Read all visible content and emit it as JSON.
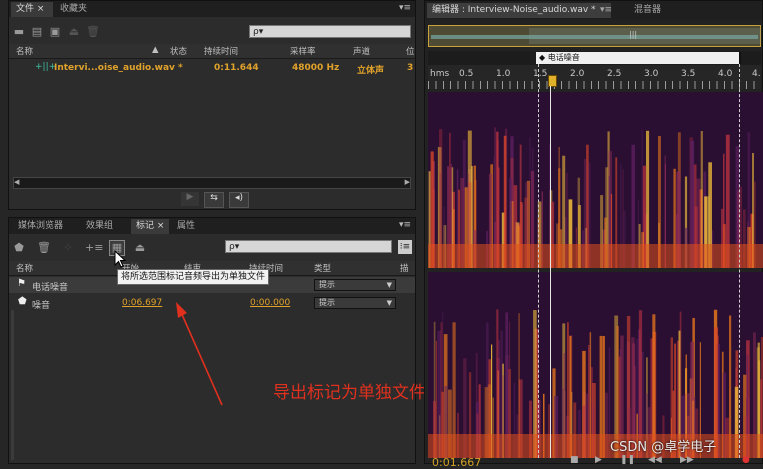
{
  "files_panel": {
    "tabs": [
      "文件 ×",
      "收藏夹"
    ],
    "search_placeholder": "ρ▾",
    "columns": [
      "名称",
      "状态",
      "持续时间",
      "采样率",
      "声道",
      "位"
    ],
    "file": {
      "name": "Intervi...oise_audio.wav *",
      "duration": "0:11.644",
      "sample_rate": "48000 Hz",
      "channels": "立体声",
      "bits": "3"
    }
  },
  "markers_panel": {
    "tabs": [
      "媒体浏览器",
      "效果组",
      "标记 ×",
      "属性"
    ],
    "search_placeholder": "ρ▾",
    "columns": [
      "名称",
      "开始",
      "结束",
      "持续时间",
      "类型",
      "描"
    ],
    "tooltip": "将所选范围标记音频导出为单独文件",
    "rows": [
      {
        "name": "电话噪音",
        "start": "",
        "end": "",
        "duration": "",
        "type": "提示"
      },
      {
        "name": "噪音",
        "start": "0:06.697",
        "end": "",
        "duration": "0:00.000",
        "type": "提示"
      }
    ]
  },
  "editor": {
    "tabs": [
      "编辑器 : Interview-Noise_audio.wav *",
      "混音器"
    ],
    "marker_label": "电话噪音",
    "ruler_unit": "hms",
    "ruler_ticks": [
      "0.5",
      "1.0",
      "1.5",
      "2.0",
      "2.5",
      "3.0",
      "3.5",
      "4.0",
      "4."
    ],
    "timecode": "0:01.667"
  },
  "annotation": {
    "text": "导出标记为单独文件",
    "color": "#e0301e"
  },
  "watermark": "CSDN @卓学电子"
}
